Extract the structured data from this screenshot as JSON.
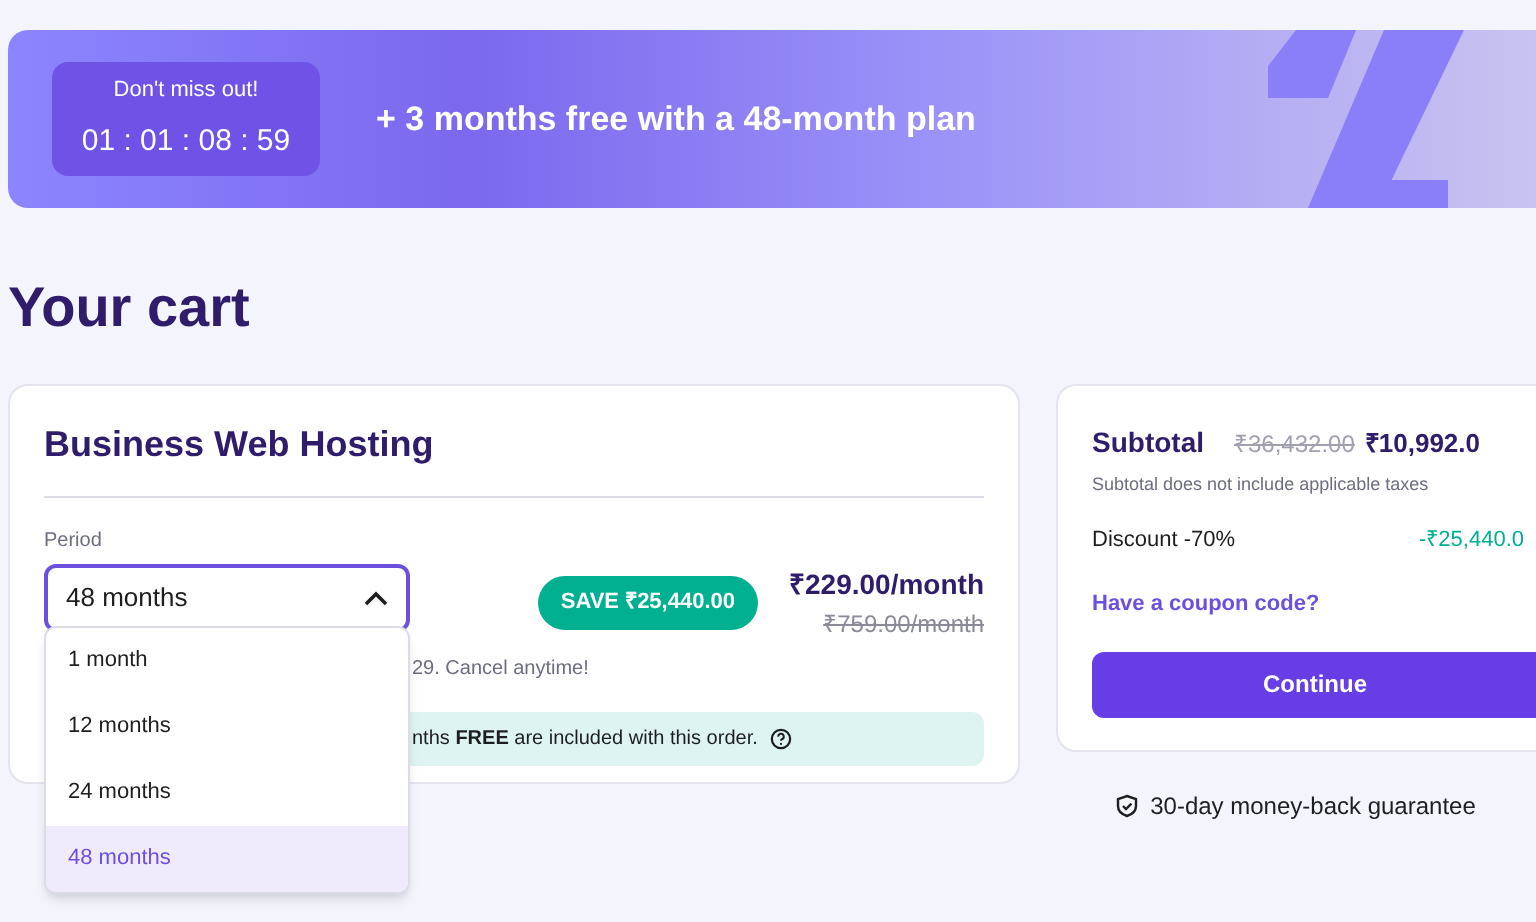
{
  "banner": {
    "countdown_label": "Don't miss out!",
    "countdown": "01 : 01 : 08 : 59",
    "offer": "+ 3 months free with a 48-month plan"
  },
  "title": "Your cart",
  "product": {
    "name": "Business Web Hosting",
    "period_label": "Period",
    "period_value": "48 months",
    "expanded": true,
    "options": [
      {
        "label": "1 month",
        "selected": false
      },
      {
        "label": "12 months",
        "selected": false
      },
      {
        "label": "24 months",
        "selected": false
      },
      {
        "label": "48 months",
        "selected": true
      }
    ],
    "save_badge": "SAVE ₹25,440.00",
    "price": "₹229.00/month",
    "old_price": "₹759.00/month",
    "renewal_note": "29. Cancel anytime!",
    "free_note": "nths **FREE** are included with this order."
  },
  "summary": {
    "subtotal_label": "Subtotal",
    "old_total": "₹36,432.00",
    "total": "₹10,992.0",
    "tax_note": "Subtotal does not include applicable taxes",
    "discount_label": "Discount -70%",
    "discount": "-₹25,440.0",
    "coupon_link": "Have a coupon code?",
    "continue_button": "Continue"
  },
  "guarantee": "30-day money-back guarantee"
}
